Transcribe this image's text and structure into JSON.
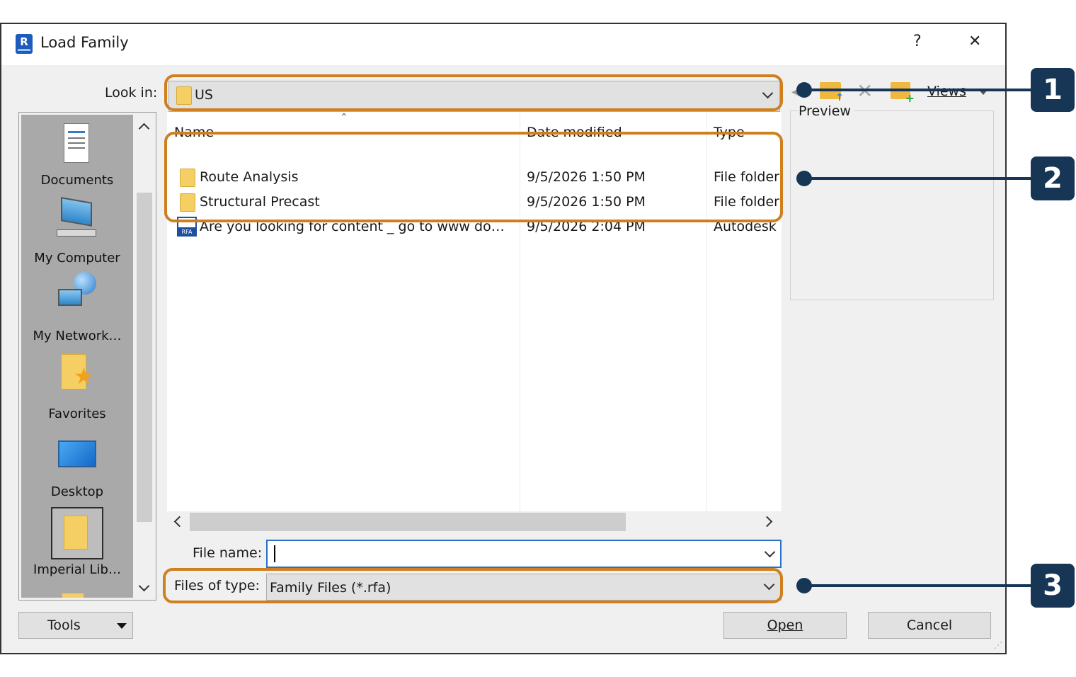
{
  "window": {
    "title": "Load Family",
    "help_glyph": "?",
    "close_glyph": "✕"
  },
  "look_in": {
    "label": "Look in:",
    "value": "US"
  },
  "toolbar": {
    "views_label": "Views",
    "preview_label": "Preview"
  },
  "places": [
    {
      "label": "Documents",
      "icon": "documents-icon"
    },
    {
      "label": "My Computer",
      "icon": "computer-icon"
    },
    {
      "label": "My Network…",
      "icon": "network-icon"
    },
    {
      "label": "Favorites",
      "icon": "favorites-icon"
    },
    {
      "label": "Desktop",
      "icon": "desktop-icon"
    },
    {
      "label": "Imperial Lib…",
      "icon": "folder-icon"
    }
  ],
  "file_list": {
    "columns": [
      "Name",
      "Date modified",
      "Type"
    ],
    "rows": [
      {
        "name": "Route Analysis",
        "date": "9/5/2026 1:50 PM",
        "type": "File folder",
        "icon": "folder-icon"
      },
      {
        "name": "Structural Precast",
        "date": "9/5/2026 1:50 PM",
        "type": "File folder",
        "icon": "folder-icon"
      },
      {
        "name": "Are you looking for content _ go to www do…",
        "date": "9/5/2026 2:04 PM",
        "type": "Autodesk",
        "icon": "rfa-file-icon"
      }
    ]
  },
  "file_name": {
    "label": "File name:",
    "value": ""
  },
  "file_type": {
    "label": "Files of type:",
    "value": "Family Files (*.rfa)"
  },
  "buttons": {
    "tools": "Tools",
    "open": "Open",
    "cancel": "Cancel"
  },
  "callouts": [
    "1",
    "2",
    "3"
  ],
  "colors": {
    "highlight": "#d07f1f",
    "callout": "#173656",
    "places_bg": "#a9a9a9"
  }
}
